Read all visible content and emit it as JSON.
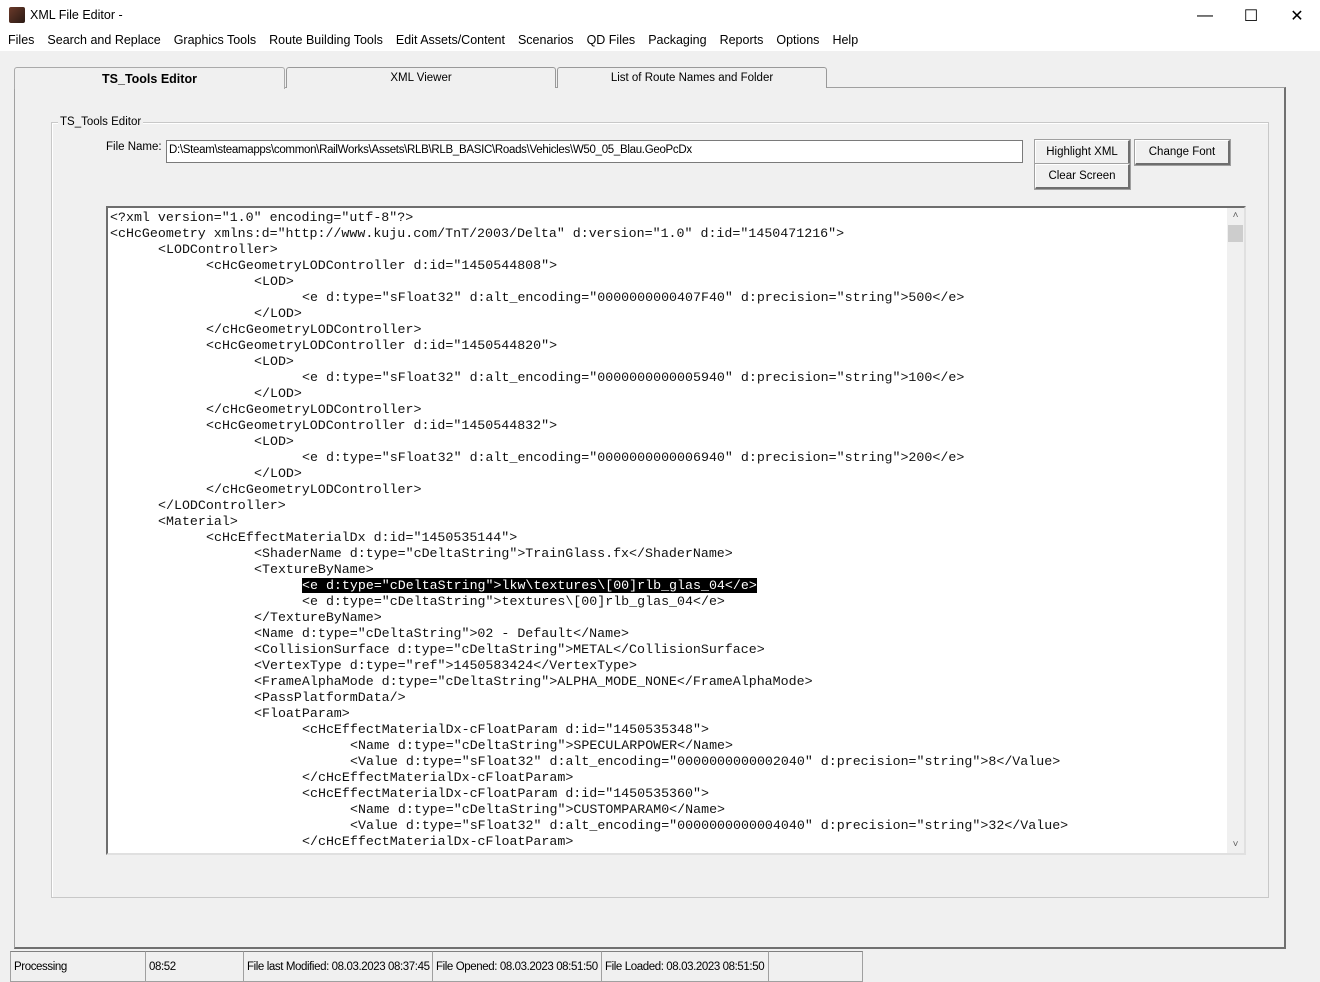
{
  "window": {
    "title": "XML File Editor -",
    "minimize": "—",
    "maximize": "☐",
    "close": "✕"
  },
  "menu": [
    "Files",
    "Search and Replace",
    "Graphics Tools",
    "Route Building Tools",
    "Edit Assets/Content",
    "Scenarios",
    "QD Files",
    "Packaging",
    "Reports",
    "Options",
    "Help"
  ],
  "tabs": [
    {
      "label": "TS_Tools Editor",
      "active": true
    },
    {
      "label": "XML Viewer"
    },
    {
      "label": "List of Route Names and Folder"
    }
  ],
  "editor": {
    "group_label": "TS_Tools Editor",
    "file_name_label": "File Name:",
    "file_name_value": "D:\\Steam\\steamapps\\common\\RailWorks\\Assets\\RLB\\RLB_BASIC\\Roads\\Vehicles\\W50_05_Blau.GeoPcDx",
    "highlight_xml": "Highlight XML",
    "change_font": "Change Font",
    "clear_screen": "Clear Screen",
    "highlighted_line": 23,
    "lines": [
      {
        "level": 0,
        "text": "<?xml version=\"1.0\" encoding=\"utf-8\"?>"
      },
      {
        "level": 0,
        "text": "<cHcGeometry xmlns:d=\"http://www.kuju.com/TnT/2003/Delta\" d:version=\"1.0\" d:id=\"1450471216\">"
      },
      {
        "level": 1,
        "text": "<LODController>"
      },
      {
        "level": 2,
        "text": "<cHcGeometryLODController d:id=\"1450544808\">"
      },
      {
        "level": 3,
        "text": "<LOD>"
      },
      {
        "level": 4,
        "text": "<e d:type=\"sFloat32\" d:alt_encoding=\"0000000000407F40\" d:precision=\"string\">500</e>"
      },
      {
        "level": 3,
        "text": "</LOD>"
      },
      {
        "level": 2,
        "text": "</cHcGeometryLODController>"
      },
      {
        "level": 2,
        "text": "<cHcGeometryLODController d:id=\"1450544820\">"
      },
      {
        "level": 3,
        "text": "<LOD>"
      },
      {
        "level": 4,
        "text": "<e d:type=\"sFloat32\" d:alt_encoding=\"0000000000005940\" d:precision=\"string\">100</e>"
      },
      {
        "level": 3,
        "text": "</LOD>"
      },
      {
        "level": 2,
        "text": "</cHcGeometryLODController>"
      },
      {
        "level": 2,
        "text": "<cHcGeometryLODController d:id=\"1450544832\">"
      },
      {
        "level": 3,
        "text": "<LOD>"
      },
      {
        "level": 4,
        "text": "<e d:type=\"sFloat32\" d:alt_encoding=\"0000000000006940\" d:precision=\"string\">200</e>"
      },
      {
        "level": 3,
        "text": "</LOD>"
      },
      {
        "level": 2,
        "text": "</cHcGeometryLODController>"
      },
      {
        "level": 1,
        "text": "</LODController>"
      },
      {
        "level": 1,
        "text": "<Material>"
      },
      {
        "level": 2,
        "text": "<cHcEffectMaterialDx d:id=\"1450535144\">"
      },
      {
        "level": 3,
        "text": "<ShaderName d:type=\"cDeltaString\">TrainGlass.fx</ShaderName>"
      },
      {
        "level": 3,
        "text": "<TextureByName>"
      },
      {
        "level": 4,
        "text": "<e d:type=\"cDeltaString\">lkw\\textures\\[00]rlb_glas_04</e>"
      },
      {
        "level": 4,
        "text": "<e d:type=\"cDeltaString\">textures\\[00]rlb_glas_04</e>"
      },
      {
        "level": 3,
        "text": "</TextureByName>"
      },
      {
        "level": 3,
        "text": "<Name d:type=\"cDeltaString\">02 - Default</Name>"
      },
      {
        "level": 3,
        "text": "<CollisionSurface d:type=\"cDeltaString\">METAL</CollisionSurface>"
      },
      {
        "level": 3,
        "text": "<VertexType d:type=\"ref\">1450583424</VertexType>"
      },
      {
        "level": 3,
        "text": "<FrameAlphaMode d:type=\"cDeltaString\">ALPHA_MODE_NONE</FrameAlphaMode>"
      },
      {
        "level": 3,
        "text": "<PassPlatformData/>"
      },
      {
        "level": 3,
        "text": "<FloatParam>"
      },
      {
        "level": 4,
        "text": "<cHcEffectMaterialDx-cFloatParam d:id=\"1450535348\">"
      },
      {
        "level": 5,
        "text": "<Name d:type=\"cDeltaString\">SPECULARPOWER</Name>"
      },
      {
        "level": 5,
        "text": "<Value d:type=\"sFloat32\" d:alt_encoding=\"0000000000002040\" d:precision=\"string\">8</Value>"
      },
      {
        "level": 4,
        "text": "</cHcEffectMaterialDx-cFloatParam>"
      },
      {
        "level": 4,
        "text": "<cHcEffectMaterialDx-cFloatParam d:id=\"1450535360\">"
      },
      {
        "level": 5,
        "text": "<Name d:type=\"cDeltaString\">CUSTOMPARAM0</Name>"
      },
      {
        "level": 5,
        "text": "<Value d:type=\"sFloat32\" d:alt_encoding=\"0000000000004040\" d:precision=\"string\">32</Value>"
      },
      {
        "level": 4,
        "text": "</cHcEffectMaterialDx-cFloatParam>"
      }
    ]
  },
  "status": {
    "state": "Processing",
    "time": "08:52",
    "modified": "File last Modified: 08.03.2023 08:37:45",
    "opened": "File Opened: 08.03.2023 08:51:50",
    "loaded": "File Loaded: 08.03.2023 08:51:50"
  }
}
